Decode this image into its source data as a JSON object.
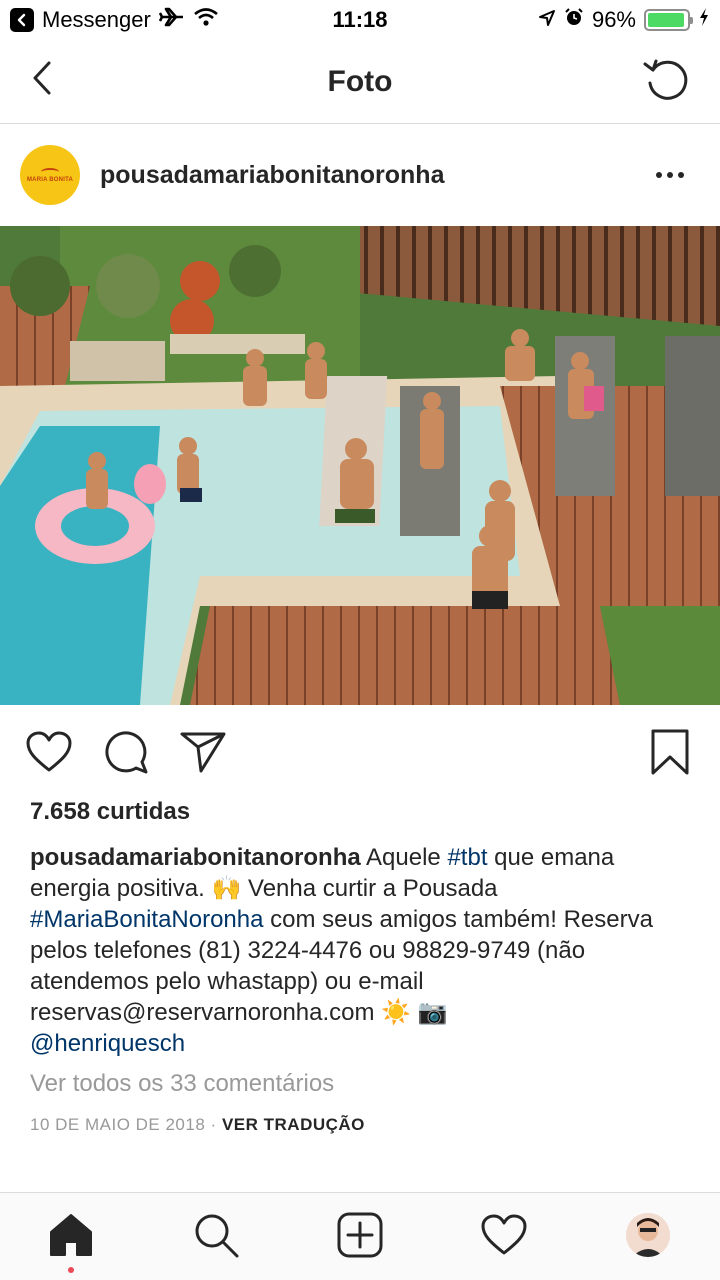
{
  "status_bar": {
    "back_app": "Messenger",
    "time": "11:18",
    "battery": "96%",
    "battery_level": 0.96
  },
  "nav": {
    "title": "Foto",
    "back_icon": "chevron-left-icon",
    "refresh_icon": "refresh-icon"
  },
  "post": {
    "username": "pousadamariabonitanoronha",
    "avatar_text": "MARIA BONITA",
    "likes": "7.658 curtidas",
    "caption": {
      "user": "pousadamariabonitanoronha",
      "t1": " Aquele ",
      "tag1": "#tbt",
      "t2": " que emana energia positiva. ",
      "emoji1": "🙌",
      "t3": " Venha curtir a Pousada ",
      "tag2": "#MariaBonitaNoronha",
      "t4": " com seus amigos também! Reserva pelos telefones (81) 3224-4476 ou 98829-9749 (não atendemos pelo whastapp) ou e-mail reservas@reservarnoronha.com ",
      "emoji2": "☀️",
      "emoji3": "📷",
      "mention": "@henriquesch"
    },
    "view_comments": "Ver todos os 33 comentários",
    "date": "10 DE MAIO DE 2018",
    "separator": "·",
    "translate": "VER TRADUÇÃO"
  },
  "tabs": [
    "home-icon",
    "search-icon",
    "new-post-icon",
    "activity-heart-icon",
    "profile-avatar"
  ],
  "colors": {
    "link": "#003569",
    "muted": "#999999",
    "avatar_bg": "#f7c516",
    "active_dot": "#ed4956"
  }
}
